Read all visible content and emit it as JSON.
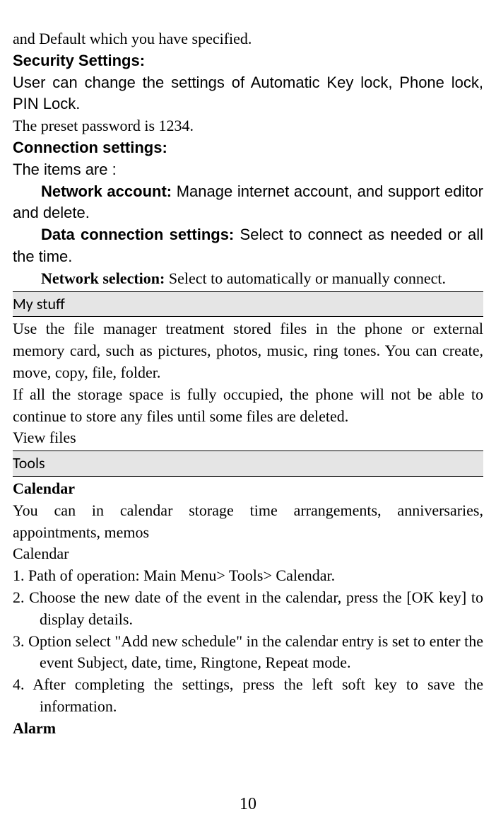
{
  "lines": {
    "l1": "and Default which you have specified.",
    "security_heading": "Security Settings:",
    "security_body": "User can change the settings of Automatic Key lock, Phone lock, PIN Lock.",
    "preset_pw": "The preset password is 1234.",
    "conn_heading": "Connection settings:",
    "conn_items": "The items are :",
    "net_account_label": "Network account: ",
    "net_account_body": "Manage internet account, and support editor and delete.",
    "data_conn_label": "Data connection settings: ",
    "data_conn_body": "Select to connect as needed or all the time.",
    "net_sel_label": "Network selection: ",
    "net_sel_body": "Select to automatically or manually connect.",
    "mystuff_heading": "My stuff",
    "mystuff_p1": "Use the file manager treatment stored files in the phone or external memory card, such as pictures, photos, music, ring tones. You can create, move, copy, file, folder.",
    "mystuff_p2": "If all the storage space is fully occupied, the phone will not be able to continue to store any files until some files are deleted.",
    "view_files": "View files",
    "tools_heading": "Tools",
    "calendar_heading": "Calendar",
    "calendar_p1": "You can in calendar storage time arrangements, anniversaries, appointments, memos",
    "calendar_sub": "Calendar",
    "cal_step1": "1. Path of operation: Main Menu> Tools> Calendar.",
    "cal_step2": "2. Choose the new date of the event in the calendar, press the [OK key] to display details.",
    "cal_step3": "3. Option select \"Add new schedule\" in the calendar entry is set to enter the event Subject, date, time, Ringtone, Repeat mode.",
    "cal_step4": "4. After completing the settings, press the left soft key to save the information.",
    "alarm_heading": "Alarm",
    "page_number": "10"
  }
}
